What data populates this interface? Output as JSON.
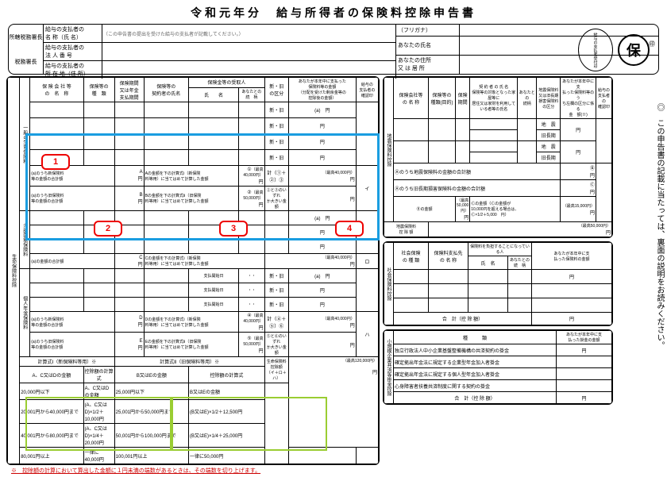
{
  "title": "令和元年分　給与所得者の保険料控除申告書",
  "header": {
    "left_top": "所轄税務署長",
    "left_bot": "税務署長",
    "payer_name_label": "給与の支払者の\n名 称（氏 名）",
    "payer_note": "（この申告書の提出を受けた給与の支払者が記載してください。）",
    "payer_corpno_label": "給与の支払者の\n法 人 番 号",
    "payer_addr_label": "給与の支払者の\n所 在 地（住 所）",
    "furigana": "（フリガナ）",
    "your_name": "あなたの氏名",
    "your_addr": "あなたの住所\n又 は 居 所",
    "seal_mark": "㊞",
    "oval": "給与の支払者受付印",
    "circle": "保"
  },
  "left_headers": {
    "h1": "保 険 会 社 等\nの　名　称",
    "h2": "保険等の\n種　類",
    "h3": "保険期間\n又は年金\n支払期間",
    "h4": "保険等の\n契約者の氏名",
    "h5": "保険金等の受取人",
    "h5a": "氏　　名",
    "h5b": "あなたとの\n続　柄",
    "h6": "新・旧\nの区分",
    "h7": "あなたが本年中に支払った\n保険料等の金額\n（分配を受けた剰余金等の\n控除後の金額）",
    "h8": "給与の\n支払者の\n確認印"
  },
  "shinkyu": "新・旧",
  "labels_ippan": "一般の生命保険料",
  "labels_kaigo": "介護医療保険料",
  "labels_kojin": "個人年金保険料",
  "labels_big": "生命保険料控除",
  "a_text": "(a)のうち新保険料\n等の金額の合計額",
  "b_text": "(a)のうち旧保険料\n等の金額の合計額",
  "c_text": "(a)の金額の合計額",
  "d_text": "(a)のうち新保険料\n等の金額の合計額",
  "e_text": "(a)のうち旧保険料\n等の金額の合計額",
  "calc1": "Aの金額を下の計算式Ⅰ（新保険\n料等用）に当てはめて計算した金額",
  "calc2": "Bの金額を下の計算式Ⅱ（旧保険\n料等用）に当てはめて計算した金額",
  "calc3": "Cの金額を下の計算式Ⅰ（新保険\n料等用）に当てはめて計算した金額",
  "calc4": "Dの金額を下の計算式Ⅰ（新保険\n料等用）に当てはめて計算した金額",
  "calc5": "Eの金額を下の計算式Ⅱ（旧保険\n料等用）に当てはめて計算した金額",
  "max40000": "（最高40,000円）",
  "max50000": "（最高50,000円）",
  "max15000": "（最高15,000円）",
  "kei1": "計（①＋②）③",
  "kei2": "②と③のいずれ\nか大きい金額",
  "kei3": "計（④＋⑤）⑥",
  "kei4": "⑤と⑥のいずれ\nか大きい金額",
  "payer_start": "支払開始日",
  "calc_title1": "計算式Ⅰ（新保険料等用）※",
  "calc_title2": "計算式Ⅱ（旧保険料等用）※",
  "seimei_label": "生命保険料控除額\n（イ＋ロ＋ハ）",
  "max120000": "（最高120,000円）",
  "calc_tbl": {
    "h11": "A、C又はDの金額",
    "h12": "控除額の計算式",
    "h21": "B又はEの金額",
    "h22": "控除額の計算式",
    "r11a": "20,000円以下",
    "r11b": "A、C又はDの金額",
    "r12a": "20,001円から40,000円まで",
    "r12b": "(A、C又はD)×1/2＋10,000円",
    "r13a": "40,001円から80,000円まで",
    "r13b": "(A、C又はD)×1/4＋20,000円",
    "r14a": "80,001円以上",
    "r14b": "一律に40,000円",
    "r21a": "25,000円以下",
    "r21b": "B又はEの金額",
    "r22a": "25,001円から50,000円まで",
    "r22b": "(B又はE)×1/2＋12,500円",
    "r23a": "50,001円から100,000円まで",
    "r23b": "(B又はE)×1/4＋25,000円",
    "r24a": "100,001円以上",
    "r24b": "一律に50,000円"
  },
  "jishin": {
    "title": "地震保険料控除",
    "h1": "保険会社等\nの 名 称",
    "h2": "保険等の\n種類(目的)",
    "h3": "保険\n期間",
    "h4": "契 約 者 の 氏 名\n保険等の対象となった家屋等に\n居住又は家財を利用している者等の氏名",
    "h5": "あなたとの\n続柄",
    "h6": "地震保険料\n又は旧長期\n損害保険料\nの区分",
    "h7": "あなたが本年中に支\n払った保険料等のう\nち左欄の区分に係る\n金　額(※)",
    "h8": "給与の\n支払者の\n確認印",
    "type1": "地　震",
    "type2": "旧長期",
    "sum1": "Ⓐのうち地震保険料の金額の合計額",
    "sum2": "Ⓐのうち旧長期損害保険料の金額の合計額",
    "b_label": "Ⓑの金額",
    "c_label": "Ⓒの金額（Ⓒの金額が\n10,000円を超える場合は、\nⒸ×1/2＋5,000　円）",
    "kojo": "地震保険料\n控 除 額"
  },
  "shakai": {
    "title": "社会保険料控除",
    "h1": "社会保険\nの 種 類",
    "h2": "保険料支払先\nの 名 称",
    "h3": "保険料を負担することになっている人",
    "h3a": "氏　名",
    "h3b": "あなたとの\n続　柄",
    "h4": "あなたが本年中に支\n払った保険料の金額",
    "sum": "合　計（控 除 額）"
  },
  "shokibo": {
    "title": "小規模企業共済等掛金控除",
    "h1": "種　　　類",
    "h2": "あなたが本年中に支\n払った掛金の金額",
    "r1": "独立行政法人中小企業基盤整備機構の共済契約の掛金",
    "r2": "確定拠出年金法に規定する企業型年金加入者掛金",
    "r3": "確定拠出年金法に規定する個人型年金加入者掛金",
    "r4": "心身障害者扶養共済制度に関する契約の掛金",
    "sum": "合　計（控 除 額）"
  },
  "side_note": "◎　この申告書の記載に当たっては、裏面の説明をお読みください。",
  "footnote": "※　控除額の計算において算出した金額に１円未満の端数があるときは、その端数を切り上げます。",
  "annotations": {
    "n1": "1",
    "n2": "2",
    "n3": "3",
    "n4": "4"
  },
  "a_mark": "A",
  "b_mark": "B",
  "c_mark": "C",
  "d_mark": "D",
  "e_mark": "E",
  "circ1": "①",
  "circ2": "②",
  "circ3": "③",
  "circ4": "④",
  "circ5": "⑤",
  "circ6": "⑥",
  "i_mark": "イ",
  "ro_mark": "ロ",
  "ha_mark": "ハ",
  "bb": "Ⓑ",
  "cc": "Ⓒ",
  "a_circ": "(a)",
  "yen": "円"
}
